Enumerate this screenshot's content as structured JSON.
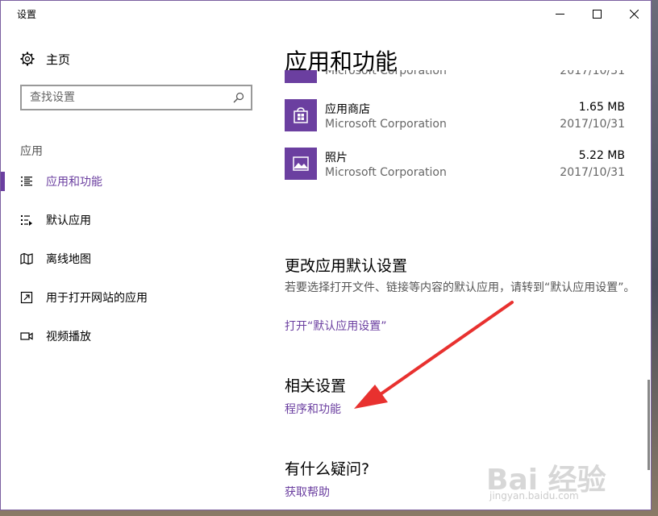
{
  "window": {
    "title": "设置"
  },
  "sidebar": {
    "home_label": "主页",
    "search_placeholder": "查找设置",
    "section_label": "应用",
    "items": [
      {
        "label": "应用和功能",
        "icon": "apps-features-icon",
        "active": true
      },
      {
        "label": "默认应用",
        "icon": "default-apps-icon"
      },
      {
        "label": "离线地图",
        "icon": "offline-maps-icon"
      },
      {
        "label": "用于打开网站的应用",
        "icon": "apps-for-websites-icon"
      },
      {
        "label": "视频播放",
        "icon": "video-playback-icon"
      }
    ]
  },
  "main": {
    "title": "应用和功能",
    "partial_app": {
      "publisher": "Microsoft Corporation",
      "date": "2017/10/31"
    },
    "apps": [
      {
        "name": "应用商店",
        "publisher": "Microsoft Corporation",
        "size": "1.65 MB",
        "date": "2017/10/31",
        "icon": "store-icon"
      },
      {
        "name": "照片",
        "publisher": "Microsoft Corporation",
        "size": "5.22 MB",
        "date": "2017/10/31",
        "icon": "photos-icon"
      }
    ],
    "default_section": {
      "heading": "更改应用默认设置",
      "description": "若要选择打开文件、链接等内容的默认应用，请转到“默认应用设置”。",
      "link": "打开“默认应用设置”"
    },
    "related": {
      "heading": "相关设置",
      "link": "程序和功能"
    },
    "question": {
      "heading": "有什么疑问?",
      "link": "获取帮助"
    }
  },
  "watermark": {
    "big": "Bai 经验",
    "small": "jingyan.baidu.com"
  },
  "colors": {
    "accent": "#6b3fa0",
    "arrow": "#e8312f"
  }
}
